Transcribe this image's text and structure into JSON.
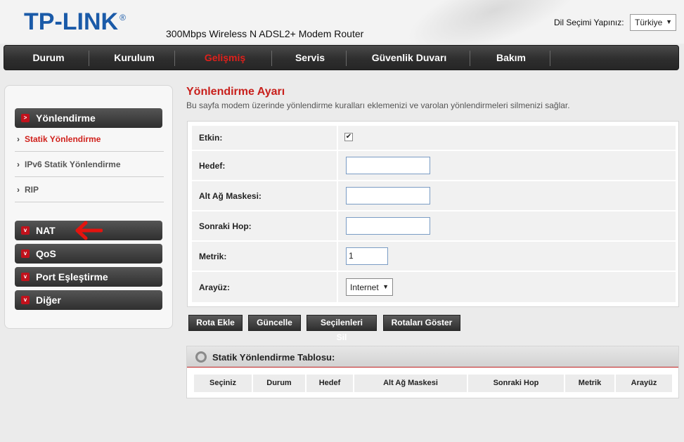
{
  "header": {
    "brand": "TP-LINK",
    "model": "300Mbps Wireless N ADSL2+ Modem Router",
    "language_label": "Dil Seçimi Yapınız:",
    "language_value": "Türkiye"
  },
  "nav": {
    "items": [
      "Durum",
      "Kurulum",
      "Gelişmiş",
      "Servis",
      "Güvenlik Duvarı",
      "Bakım"
    ],
    "active": "Gelişmiş"
  },
  "sidebar": {
    "routing": "Yönlendirme",
    "sub_items": [
      "Statik Yönlendirme",
      "IPv6 Statik Yönlendirme",
      "RIP"
    ],
    "nat": "NAT",
    "qos": "QoS",
    "port": "Port Eşleştirme",
    "other": "Diğer"
  },
  "main": {
    "title": "Yönlendirme Ayarı",
    "description": "Bu sayfa modem üzerinde yönlendirme kuralları eklemenizi ve varolan yönlendirmeleri silmenizi sağlar."
  },
  "form": {
    "enabled_label": "Etkin:",
    "enabled_checked": true,
    "destination_label": "Hedef:",
    "destination_value": "",
    "subnet_label": "Alt Ağ Maskesi:",
    "subnet_value": "",
    "nexthop_label": "Sonraki Hop:",
    "nexthop_value": "",
    "metric_label": "Metrik:",
    "metric_value": "1",
    "interface_label": "Arayüz:",
    "interface_value": "Internet"
  },
  "buttons": {
    "add": "Rota Ekle",
    "update": "Güncelle",
    "delete": "Seçilenleri Sil",
    "show": "Rotaları Göster"
  },
  "table": {
    "title": "Statik Yönlendirme Tablosu:",
    "columns": [
      "Seçiniz",
      "Durum",
      "Hedef",
      "Alt Ağ Maskesi",
      "Sonraki Hop",
      "Metrik",
      "Arayüz"
    ]
  }
}
